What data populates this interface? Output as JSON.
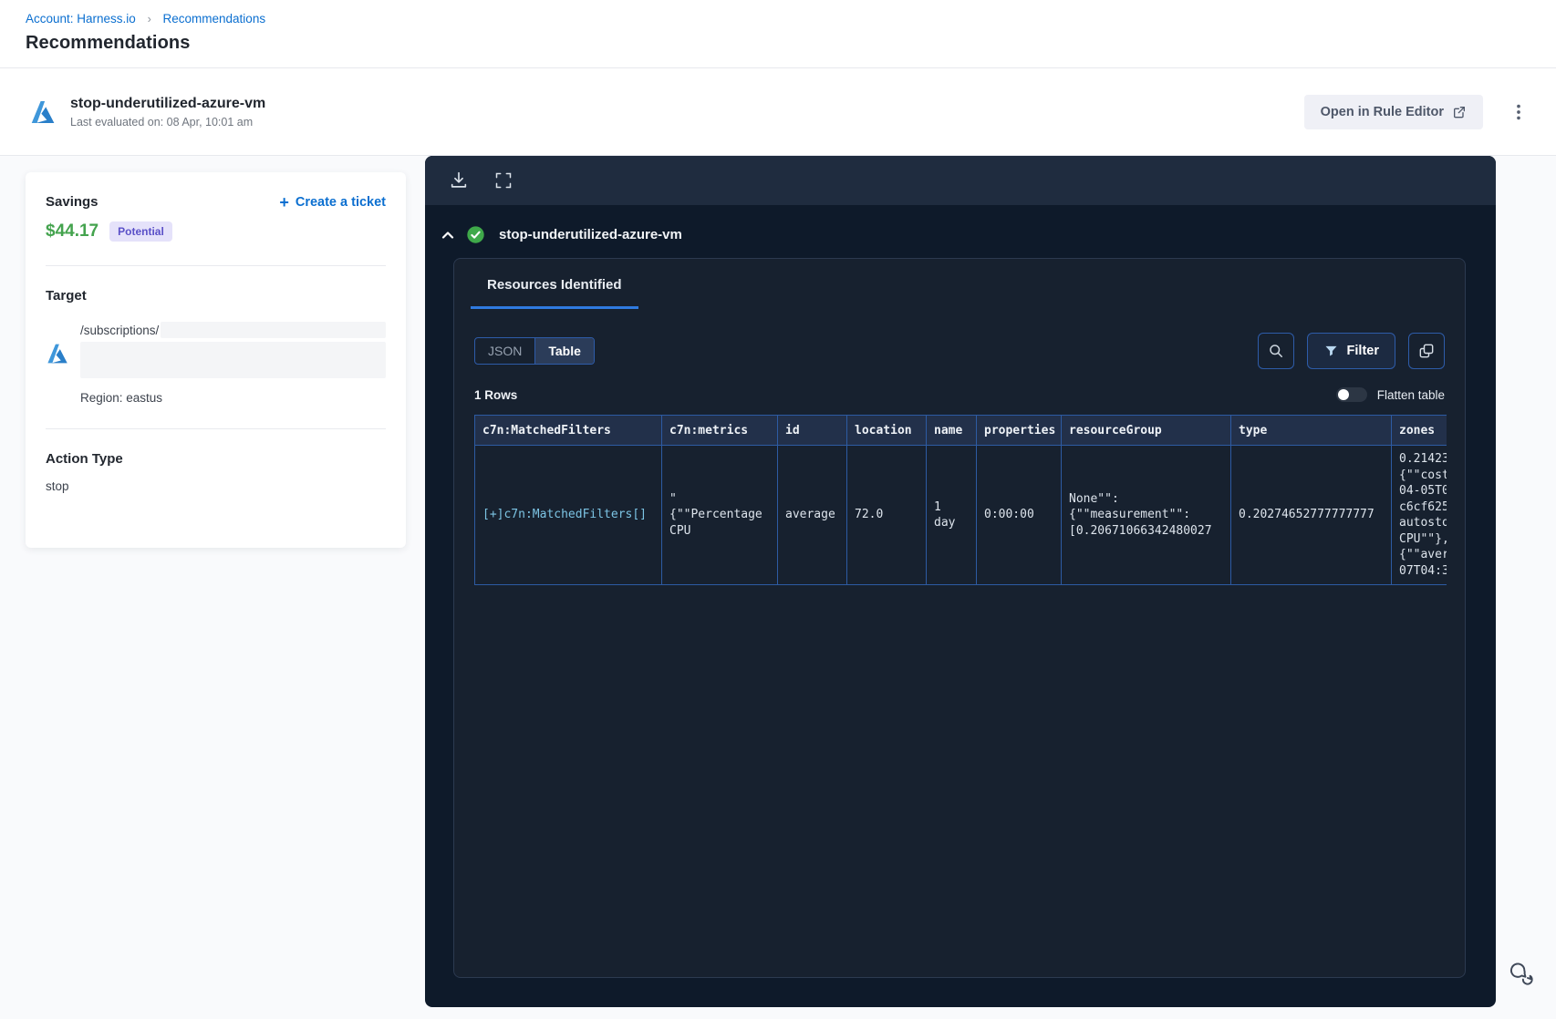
{
  "breadcrumb": {
    "account": "Account: Harness.io",
    "current": "Recommendations"
  },
  "page": {
    "title": "Recommendations"
  },
  "recommendation": {
    "name": "stop-underutilized-azure-vm",
    "last_evaluated": "Last evaluated on: 08 Apr, 10:01 am",
    "open_rule_editor": "Open in Rule Editor"
  },
  "details": {
    "savings_label": "Savings",
    "savings_amount": "$44.17",
    "savings_badge": "Potential",
    "create_ticket": "Create a ticket",
    "target_label": "Target",
    "target_path": "/subscriptions/",
    "region": "Region: eastus",
    "action_type_label": "Action Type",
    "action_type_value": "stop"
  },
  "panel": {
    "title": "stop-underutilized-azure-vm",
    "tab": "Resources Identified",
    "view_json": "JSON",
    "view_table": "Table",
    "active_view": "Table",
    "filter_label": "Filter",
    "rows_count": "1 Rows",
    "flatten_label": "Flatten table",
    "table": {
      "columns": [
        "c7n:MatchedFilters",
        "c7n:metrics",
        "id",
        "location",
        "name",
        "properties",
        "resourceGroup",
        "type",
        "zones"
      ],
      "rows": [
        [
          "[+]c7n:MatchedFilters[]",
          "\"\n{\"\"Percentage\nCPU",
          "average",
          "72.0",
          "1\nday",
          "0:00:00",
          "None\"\":\n{\"\"measurement\"\":\n[0.20671066342480027",
          "0.20274652777777777",
          "0.21423\n{\"\"cost\n04-05T0\nc6cf625\nautosto\nCPU\"\"},\n{\"\"aver\n07T04:3"
        ]
      ]
    }
  },
  "icons": {
    "toolbar": [
      "download-icon",
      "fullscreen-icon"
    ],
    "header": [
      "azure-logo",
      "external-link-icon",
      "kebab-menu-icon"
    ],
    "panel": [
      "collapse-chevron-icon",
      "success-check-icon",
      "search-icon",
      "filter-funnel-icon",
      "copy-icon"
    ],
    "footer": [
      "chat-bubbles-icon"
    ]
  },
  "colors": {
    "link_blue": "#0b6fd0",
    "savings_green": "#44a34e",
    "badge_bg": "#e5e2fa",
    "badge_text": "#5a50c8",
    "panel_bg": "#0e1a2a",
    "toolbar_bg": "#1f2c3f",
    "inner_card_bg": "#17212f",
    "table_border": "#2d5ba3",
    "table_header_bg": "#22304a",
    "tab_underline": "#2f7ae0",
    "success_green": "#3fa94a",
    "matched_filters_link": "#7cc4e4"
  }
}
